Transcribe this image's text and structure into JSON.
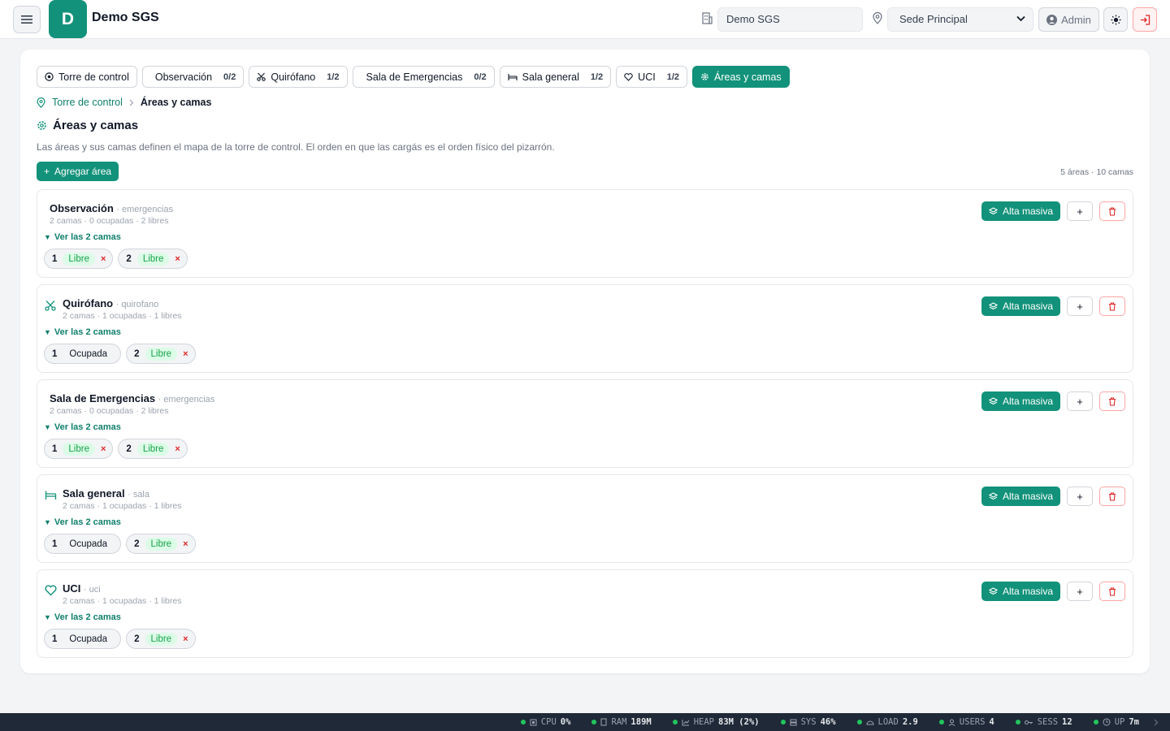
{
  "header": {
    "logo_letter": "D",
    "app_title": "Demo SGS",
    "org_value": "Demo SGS",
    "site_value": "Sede Principal",
    "user_label": "Admin"
  },
  "tabs": [
    {
      "label": "Torre de control",
      "count": "",
      "icon": "target-icon"
    },
    {
      "label": "Observación",
      "count": "0/2",
      "icon": ""
    },
    {
      "label": "Quirófano",
      "count": "1/2",
      "icon": "scissors-icon"
    },
    {
      "label": "Sala de Emergencias",
      "count": "0/2",
      "icon": ""
    },
    {
      "label": "Sala general",
      "count": "1/2",
      "icon": "bed-icon"
    },
    {
      "label": "UCI",
      "count": "1/2",
      "icon": "heart-icon"
    },
    {
      "label": "Áreas y camas",
      "count": "",
      "icon": "gear-icon",
      "active": true
    }
  ],
  "breadcrumb": {
    "root": "Torre de control",
    "current": "Áreas y camas"
  },
  "page": {
    "title": "Áreas y camas",
    "description": "Las áreas y sus camas definen el mapa de la torre de control. El orden en que las cargás es el orden físico del pizarrón.",
    "add_button": "Agregar área",
    "summary": "5 áreas · 10 camas"
  },
  "actions": {
    "alta_label": "Alta masiva",
    "add_symbol": "+",
    "remove_symbol": "×"
  },
  "areas": [
    {
      "name": "Observación",
      "type": "· emergencias",
      "icon": "",
      "stats": "2 camas · 0 ocupadas · 2 libres",
      "toggle": "Ver las 2 camas",
      "beds": [
        {
          "num": "1",
          "status": "Libre"
        },
        {
          "num": "2",
          "status": "Libre"
        }
      ]
    },
    {
      "name": "Quirófano",
      "type": "· quirofano",
      "icon": "scissors-icon",
      "stats": "2 camas · 1 ocupadas · 1 libres",
      "toggle": "Ver las 2 camas",
      "beds": [
        {
          "num": "1",
          "status": "Ocupada"
        },
        {
          "num": "2",
          "status": "Libre"
        }
      ]
    },
    {
      "name": "Sala de Emergencias",
      "type": "· emergencias",
      "icon": "",
      "stats": "2 camas · 0 ocupadas · 2 libres",
      "toggle": "Ver las 2 camas",
      "beds": [
        {
          "num": "1",
          "status": "Libre"
        },
        {
          "num": "2",
          "status": "Libre"
        }
      ]
    },
    {
      "name": "Sala general",
      "type": "· sala",
      "icon": "bed-icon",
      "stats": "2 camas · 1 ocupadas · 1 libres",
      "toggle": "Ver las 2 camas",
      "beds": [
        {
          "num": "1",
          "status": "Ocupada"
        },
        {
          "num": "2",
          "status": "Libre"
        }
      ]
    },
    {
      "name": "UCI",
      "type": "· uci",
      "icon": "heart-icon",
      "stats": "2 camas · 1 ocupadas · 1 libres",
      "toggle": "Ver las 2 camas",
      "beds": [
        {
          "num": "1",
          "status": "Ocupada"
        },
        {
          "num": "2",
          "status": "Libre"
        }
      ]
    }
  ],
  "statusbar": [
    {
      "label": "CPU",
      "value": "0%",
      "icon": "cpu-icon"
    },
    {
      "label": "RAM",
      "value": "189M",
      "icon": "memory-icon"
    },
    {
      "label": "HEAP",
      "value": "83M (2%)",
      "icon": "chart-icon"
    },
    {
      "label": "SYS",
      "value": "46%",
      "icon": "server-icon"
    },
    {
      "label": "LOAD",
      "value": "2.9",
      "icon": "gauge-icon"
    },
    {
      "label": "USERS",
      "value": "4",
      "icon": "user-icon"
    },
    {
      "label": "SESS",
      "value": "12",
      "icon": "key-icon"
    },
    {
      "label": "UP",
      "value": "7m",
      "icon": "clock-icon"
    }
  ],
  "colors": {
    "accent": "#12927a",
    "danger": "#dc2626",
    "libre_bg": "#dcfce7",
    "libre_fg": "#16a34a",
    "statusbar_bg": "#1f2937"
  }
}
